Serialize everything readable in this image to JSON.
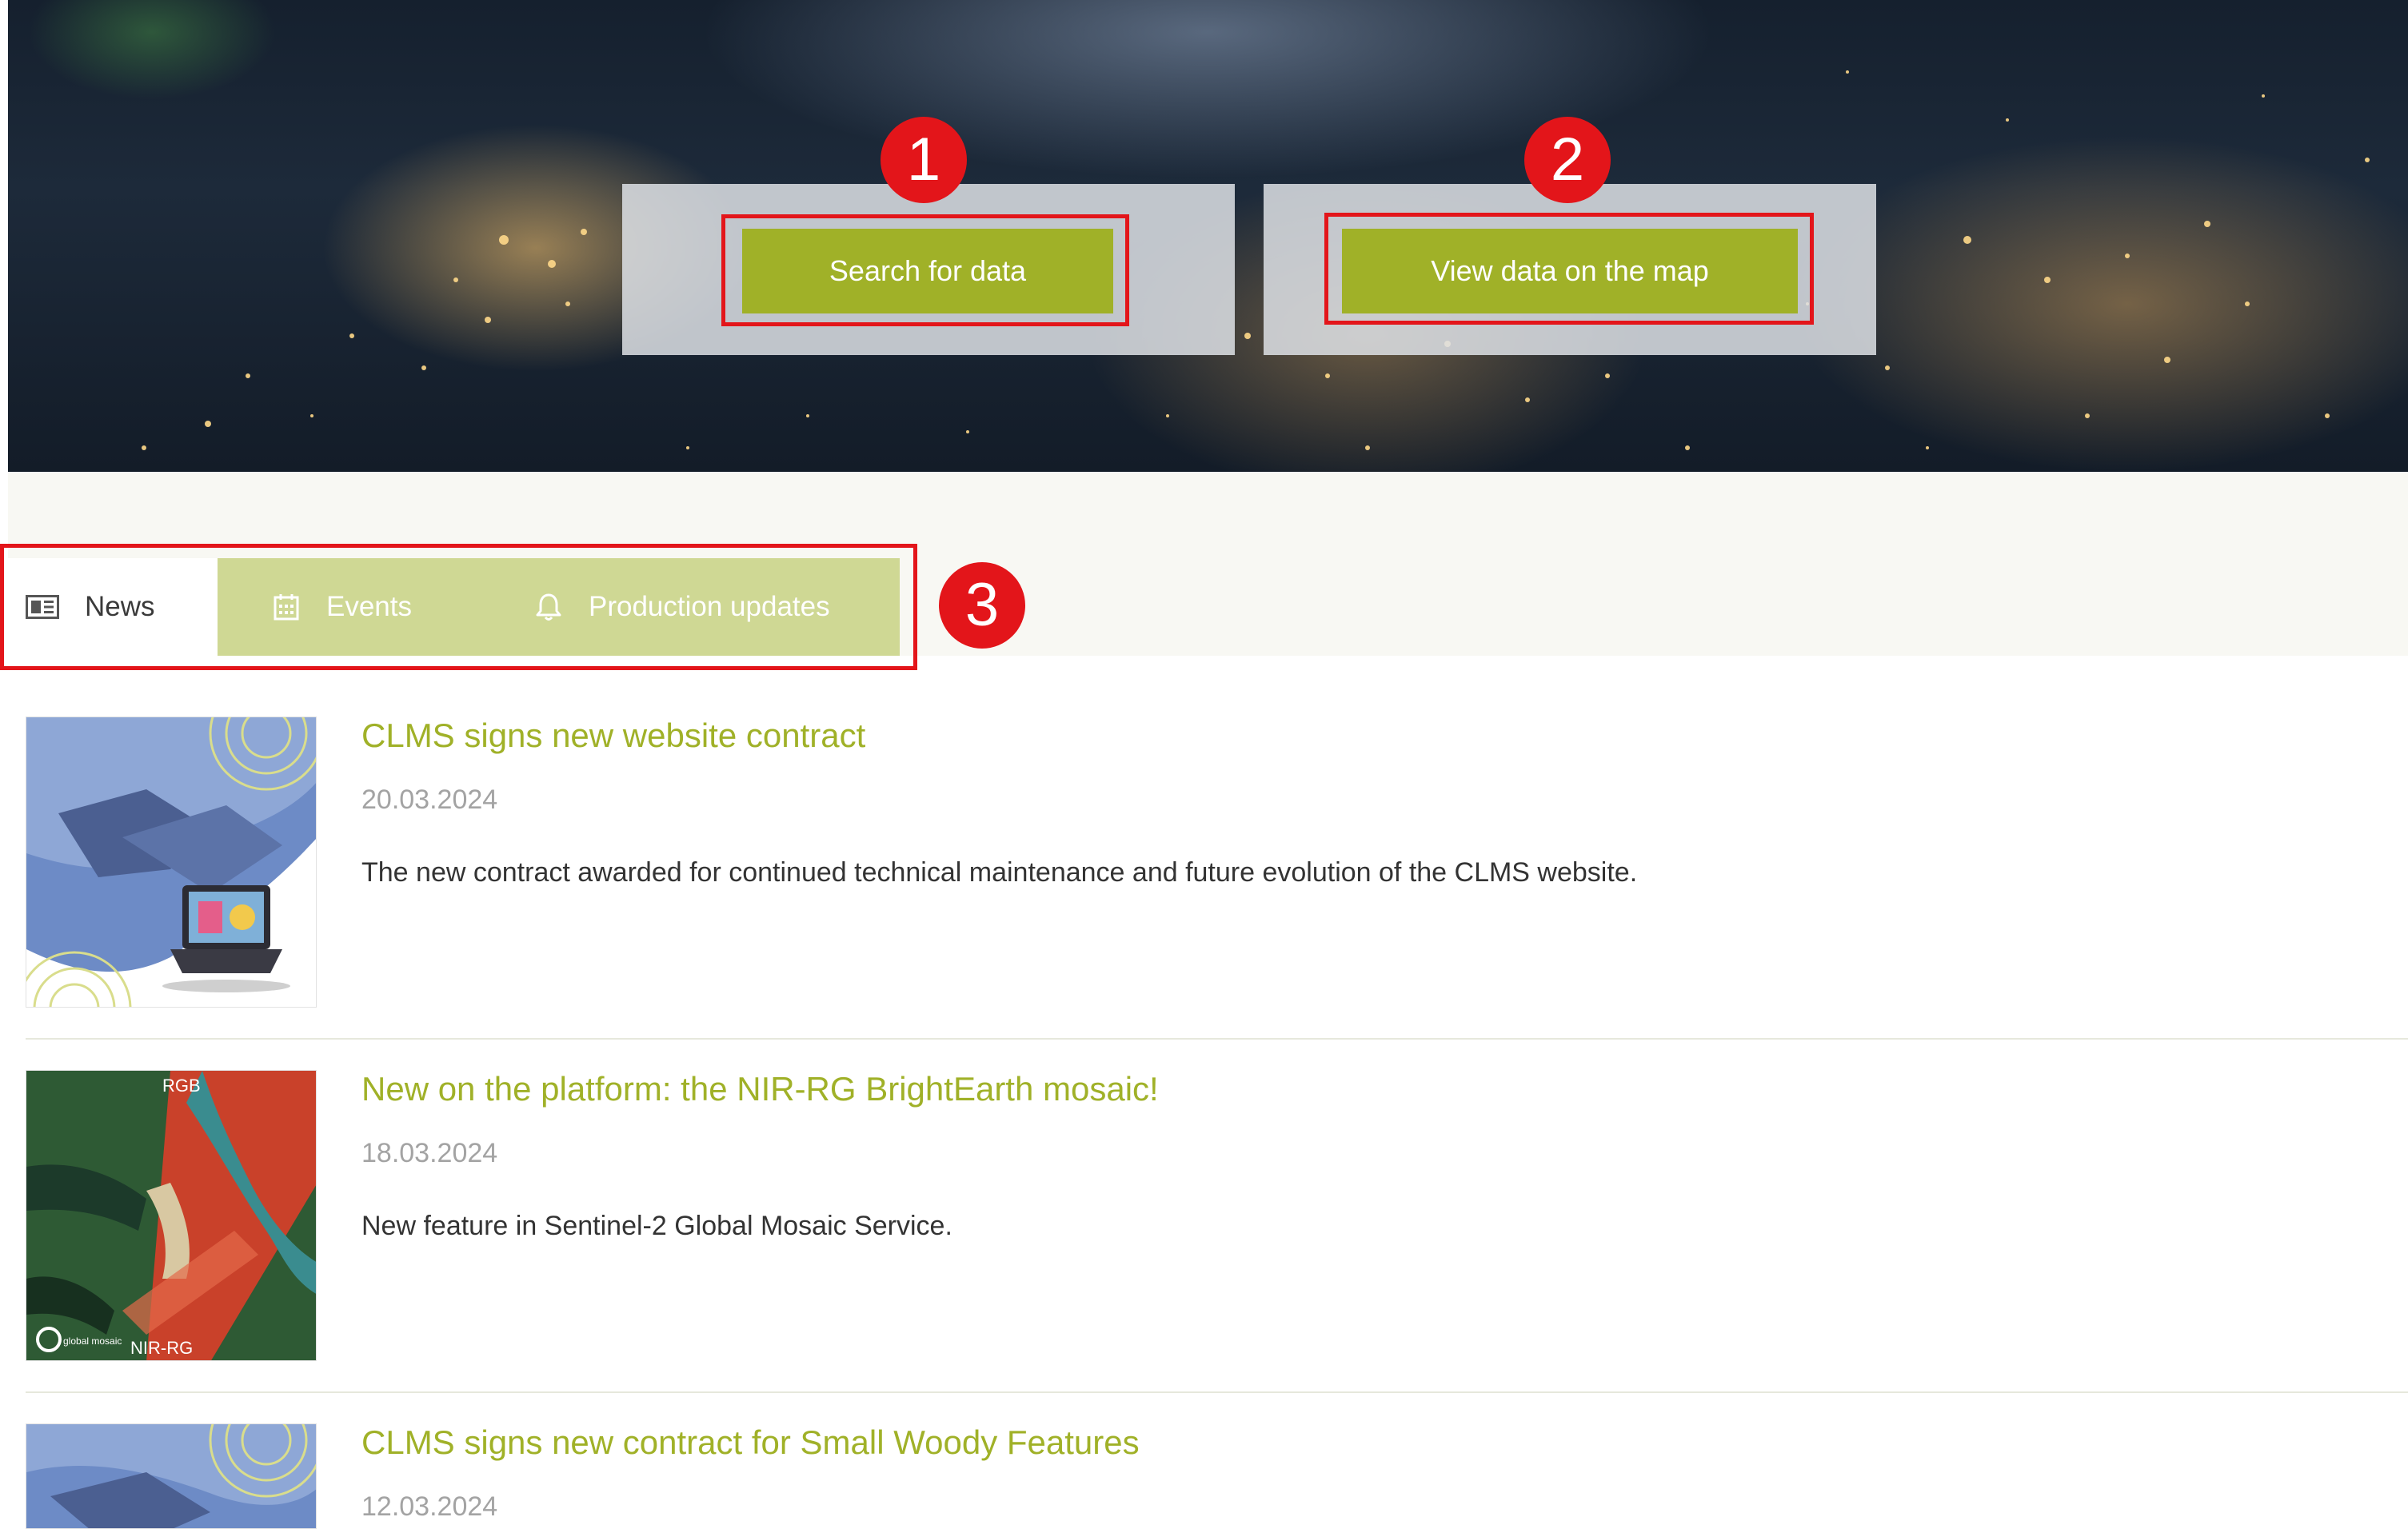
{
  "hero": {
    "search_label": "Search for data",
    "map_label": "View data on the map"
  },
  "markers": [
    "1",
    "2",
    "3"
  ],
  "tabs": [
    {
      "label": "News",
      "icon": "newspaper-icon",
      "active": true
    },
    {
      "label": "Events",
      "icon": "calendar-icon",
      "active": false
    },
    {
      "label": "Production updates",
      "icon": "bell-icon",
      "active": false
    }
  ],
  "news": [
    {
      "title": "CLMS signs new website contract",
      "date": "20.03.2024",
      "description": "The new contract awarded for continued technical maintenance and future evolution of the CLMS website.",
      "thumb": "handshake-laptop-image"
    },
    {
      "title": "New on the platform: the NIR-RG BrightEarth mosaic!",
      "date": "18.03.2024",
      "description": "New feature in Sentinel-2 Global Mosaic Service.",
      "thumb": "satellite-mosaic-image",
      "thumb_labels": {
        "top": "RGB",
        "bottom": "NIR-RG",
        "logo": "global mosaic"
      }
    },
    {
      "title": "CLMS signs new contract for Small Woody Features",
      "date": "12.03.2024",
      "thumb": "handshake-image"
    }
  ],
  "colors": {
    "accent": "#a0b128",
    "tab_inactive": "#cfd894",
    "annotation": "#e3151a",
    "date": "#a3a3a3"
  }
}
